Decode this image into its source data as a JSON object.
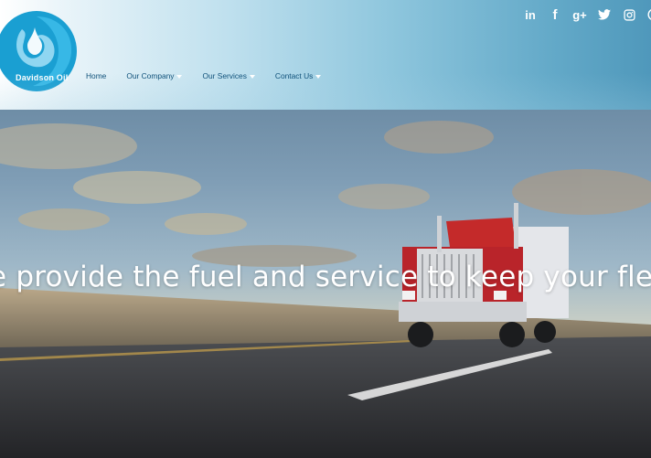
{
  "brand": {
    "name": "Davidson Oil",
    "primary_color": "#1a9fd2",
    "nav_color": "#0d4f78"
  },
  "nav": {
    "items": [
      {
        "label": "Home",
        "has_dropdown": false
      },
      {
        "label": "Our Company",
        "has_dropdown": true
      },
      {
        "label": "Our Services",
        "has_dropdown": true
      },
      {
        "label": "Contact Us",
        "has_dropdown": true
      }
    ]
  },
  "social": {
    "icons": [
      "linkedin-icon",
      "facebook-icon",
      "google-plus-icon",
      "twitter-icon",
      "instagram-icon",
      "other-social-icon"
    ],
    "labels": {
      "linkedin": "in",
      "facebook": "f",
      "google_plus": "g+"
    }
  },
  "hero": {
    "headline": "e provide the fuel and service to keep your fleet moving"
  }
}
